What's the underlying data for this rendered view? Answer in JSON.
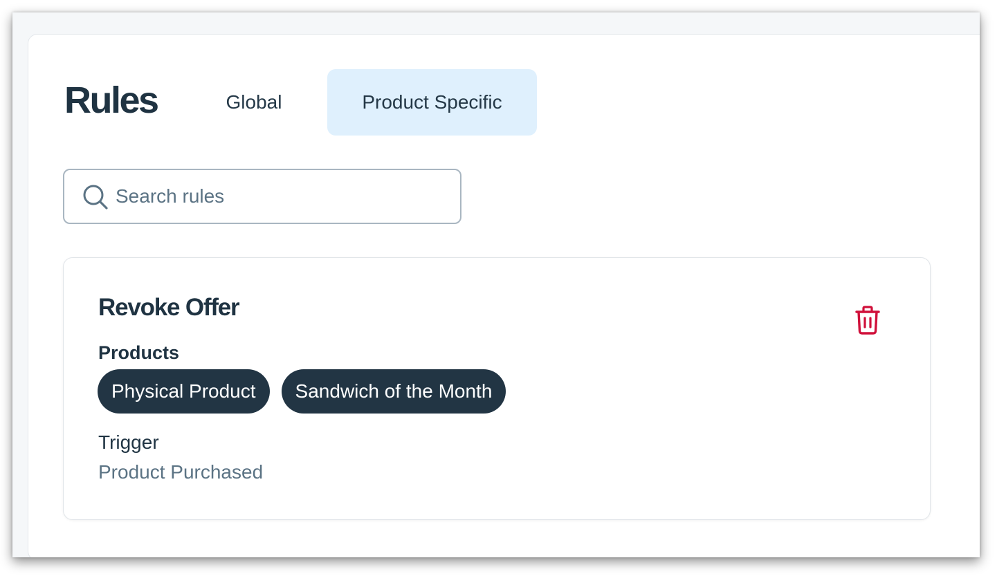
{
  "header": {
    "title": "Rules",
    "tabs": [
      {
        "label": "Global",
        "selected": false
      },
      {
        "label": "Product Specific",
        "selected": true
      }
    ]
  },
  "search": {
    "placeholder": "Search rules",
    "value": "",
    "icon": "search-icon"
  },
  "rule": {
    "title": "Revoke Offer",
    "delete_icon": "trash-icon",
    "products_label": "Products",
    "products": [
      "Physical Product",
      "Sandwich of the Month"
    ],
    "trigger_label": "Trigger",
    "trigger_value": "Product Purchased"
  },
  "colors": {
    "title_text": "#1f3342",
    "selected_tab_bg": "#dff0fd",
    "chip_bg": "#223544",
    "chip_text": "#ffffff",
    "muted_text": "#5b7384",
    "delete_icon": "#d0103a"
  }
}
